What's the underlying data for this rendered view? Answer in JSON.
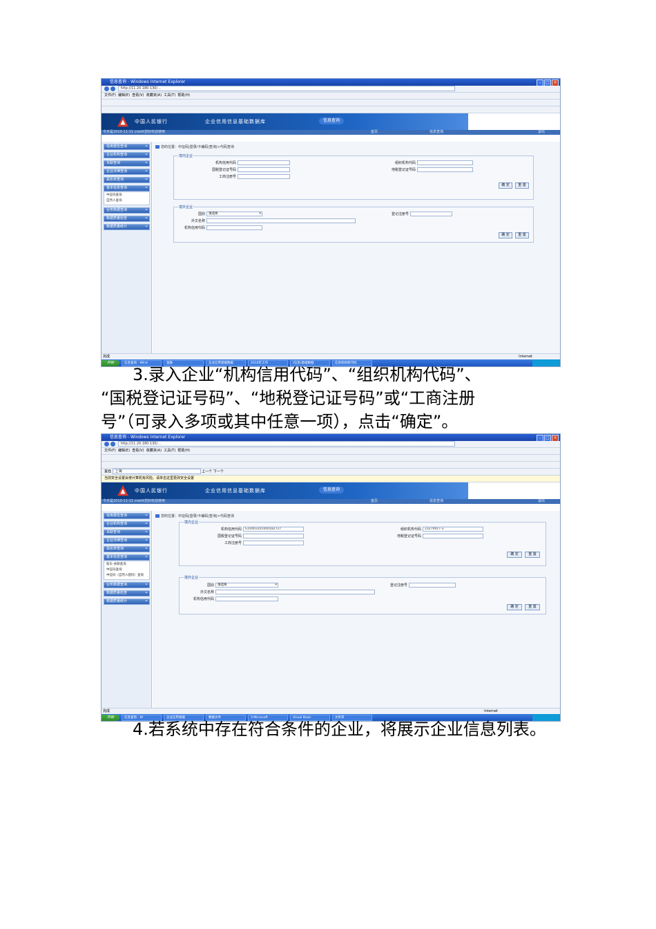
{
  "screens": [
    {
      "window_title": "信息查询 - Windows Internet Explorer",
      "address": "http://11.20.180.130/...",
      "menu": [
        "文件(F)",
        "编辑(E)",
        "查看(V)",
        "收藏夹(A)",
        "工具(T)",
        "帮助(H)"
      ],
      "banner_org": "中国人民银行",
      "banner_title": "企业信用信息基础数据库",
      "banner_mid": "信息查询",
      "stripe_user": "今天是2010-11-11 credit您好欢迎使用",
      "stripe_links": [
        "首页",
        "信息查询",
        "退出"
      ],
      "breadcrumb": "您的位置：中征码|登录/卡编码|查询|>代码查询",
      "sidebar": [
        "信用报告查询",
        "企业机构查询",
        "关联查询",
        "企业法律查询",
        "黑名单查询",
        "基本信息查询",
        "业务数据查询",
        "数据质量检查",
        "数据质量统计"
      ],
      "submenu": [
        "中征码查询",
        "自然人查询"
      ],
      "domestic": {
        "legend": "境内企业",
        "labels": {
          "credit_code": "机构信用代码",
          "org_code": "组织机构代码",
          "national_tax": "国税登记证号码",
          "local_tax": "地税登记证号码",
          "business_reg": "工商注册号"
        },
        "values": {
          "credit_code": "",
          "org_code": ""
        }
      },
      "foreign": {
        "legend": "境外企业",
        "labels": {
          "country": "国别",
          "reg_no": "登记注册号",
          "foreign_name": "外文名称",
          "credit_code": "机构信用代码"
        },
        "country_value": "请选择"
      },
      "buttons": {
        "ok": "确 定",
        "reset": "重 置"
      },
      "status_left": "完成",
      "status_right": "Internet",
      "start": "开始",
      "tasks": [
        "信息查询 - Wind",
        "金融",
        "企业信用基础数据",
        "2010年工作",
        "(信息)基础数据",
        "信息机构新代码"
      ]
    },
    {
      "window_title": "信息查询 - Windows Internet Explorer",
      "address": "http://11.20.180.130/...",
      "menu": [
        "文件(F)",
        "编辑(E)",
        "查看(V)",
        "收藏夹(A)",
        "工具(T)",
        "帮助(H)"
      ],
      "find_label": "查找",
      "find_value": "上海",
      "find_prev": "上一个",
      "find_next": "下一个",
      "security_notice": "当前安全设置会使计算机有风险。请单击这里更改安全设置",
      "banner_org": "中国人民银行",
      "banner_title": "企业信用信息基础数据库",
      "banner_mid": "信息查询",
      "stripe_user": "今天是2010-11-11 credit您好欢迎使用",
      "stripe_links": [
        "首页",
        "信息查询",
        "退出"
      ],
      "breadcrumb": "您的位置：中征码|登录/卡编码|查询|>代码查询",
      "sidebar": [
        "信用报告查询",
        "企业机构查询",
        "关联查询",
        "企业法律查询",
        "黑名单查询",
        "基本信息查询",
        "业务数据查询",
        "数据质量检查",
        "数据质量统计"
      ],
      "submenu": [
        "股东-关联查询",
        "中征码查询",
        "中征码（自然人配码）查询"
      ],
      "domestic": {
        "legend": "境内企业",
        "labels": {
          "credit_code": "机构信用代码",
          "org_code": "组织机构代码",
          "national_tax": "国税登记证号码",
          "local_tax": "地税登记证号码",
          "business_reg": "工商注册号"
        },
        "values": {
          "credit_code": "G10403101000182727",
          "org_code": "23270917-3"
        }
      },
      "foreign": {
        "legend": "境外企业",
        "labels": {
          "country": "国别",
          "reg_no": "登记注册号",
          "foreign_name": "外文名称",
          "credit_code": "机构信用代码"
        },
        "country_value": "请选择"
      },
      "buttons": {
        "ok": "确 定",
        "reset": "重 置"
      },
      "status_left": "完成",
      "status_right": "Internet",
      "start": "开始",
      "tasks": [
        "信息查询 - W",
        "企业信用基础",
        "数据文件",
        "3 Microsoft",
        "Visual Basic",
        "文件夹"
      ]
    }
  ],
  "text": {
    "step3_line1": "3.录入企业“机构信用代码”、“组织机构代码”、",
    "step3_line2": "“国税登记证号码”、“地税登记证号码”或“工商注册",
    "step3_line3": "号”（可录入多项或其中任意一项），点击“确定”。",
    "step4": "4.若系统中存在符合条件的企业，将展示企业信息列表。"
  },
  "colors": {
    "titlebar": "#1a44a8",
    "banner": "#1f66c4",
    "sidebar": "#2e63b8",
    "taskbar": "#1d56c1",
    "start": "#2e8a2b"
  }
}
